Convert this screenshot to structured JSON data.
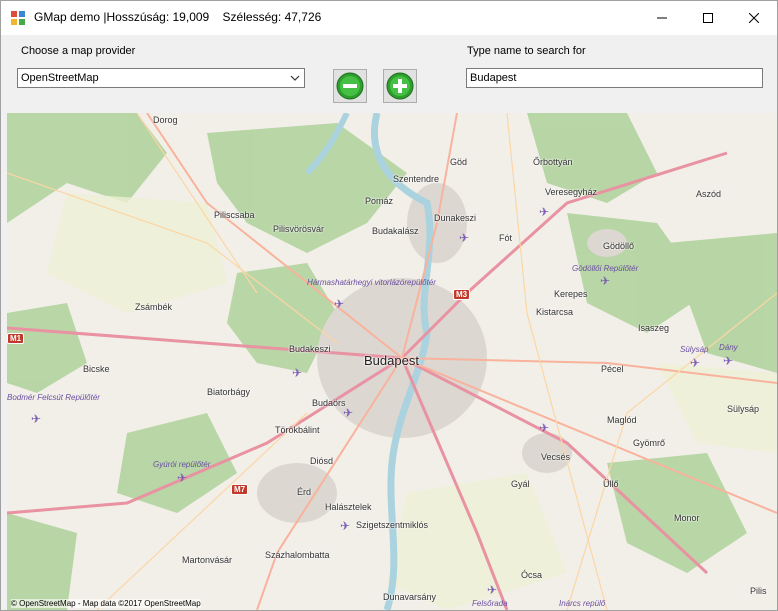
{
  "window": {
    "title": "GMap demo |Hosszúság: 19,009    Szélesség: 47,726"
  },
  "toolbar": {
    "provider_label": "Choose a map provider",
    "provider_selected": "OpenStreetMap",
    "search_label": "Type  name to search for",
    "search_value": "Budapest"
  },
  "map": {
    "places": [
      {
        "name": "Dorog"
      },
      {
        "name": "Göd"
      },
      {
        "name": "Őrbottyán"
      },
      {
        "name": "Szentendre"
      },
      {
        "name": "Veresegyház"
      },
      {
        "name": "Pomáz"
      },
      {
        "name": "Dunakeszi"
      },
      {
        "name": "Aszód"
      },
      {
        "name": "Piliscsaba"
      },
      {
        "name": "Pilisvörösvár"
      },
      {
        "name": "Budakalász"
      },
      {
        "name": "Fót"
      },
      {
        "name": "Gödöllő"
      },
      {
        "name": "Zsámbék"
      },
      {
        "name": "Kerepes"
      },
      {
        "name": "Kistarcsa"
      },
      {
        "name": "Isaszeg"
      },
      {
        "name": "Budakeszi"
      },
      {
        "name": "Budapest"
      },
      {
        "name": "Bicske"
      },
      {
        "name": "Pécel"
      },
      {
        "name": "Biatorbágy"
      },
      {
        "name": "Budaörs"
      },
      {
        "name": "Sülysáp"
      },
      {
        "name": "Törökbálint"
      },
      {
        "name": "Maglód"
      },
      {
        "name": "Gyömrő"
      },
      {
        "name": "Diósd"
      },
      {
        "name": "Vecsés"
      },
      {
        "name": "Gyál"
      },
      {
        "name": "Érd"
      },
      {
        "name": "Üllő"
      },
      {
        "name": "Halásztelek"
      },
      {
        "name": "Szigetszentmiklós"
      },
      {
        "name": "Monor"
      },
      {
        "name": "Martonvásár"
      },
      {
        "name": "Százhalombatta"
      },
      {
        "name": "Ócsa"
      },
      {
        "name": "Pilis"
      },
      {
        "name": "Dunavarsány"
      }
    ],
    "airports": [
      {
        "name": "Hármashatárhegyi vitorlázórepülőtér"
      },
      {
        "name": "Gödöllői Repülőtér"
      },
      {
        "name": "Sülysáp"
      },
      {
        "name": "Dány"
      },
      {
        "name": "Bodmér Felcsút Repülőtér"
      },
      {
        "name": "Gyúrói repülőtér"
      },
      {
        "name": "Felsőrada"
      },
      {
        "name": "Inárcs repülő"
      }
    ],
    "shields": [
      "M1",
      "M3",
      "M7"
    ],
    "attribution": "© OpenStreetMap - Map data ©2017 OpenStreetMap"
  }
}
